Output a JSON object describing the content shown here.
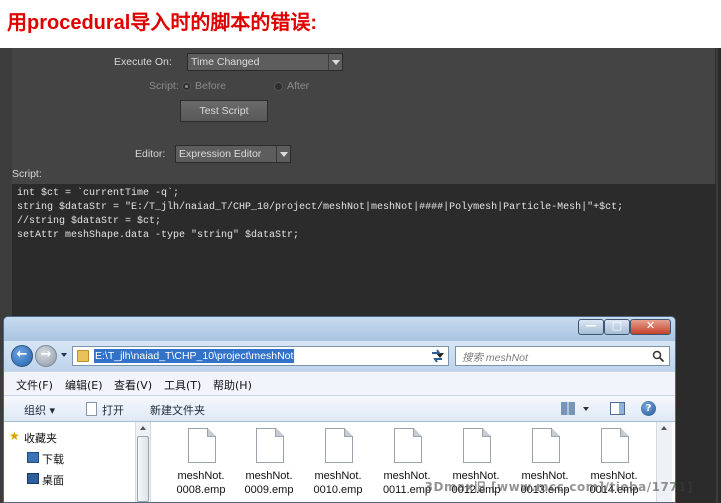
{
  "heading": "用procedural导入时的脚本的错误:",
  "expression_editor": {
    "execute_on_label": "Execute On:",
    "execute_on_value": "Time Changed",
    "script_label": "Script:",
    "before_label": "Before",
    "after_label": "After",
    "test_script_button": "Test Script",
    "editor_label": "Editor:",
    "editor_value": "Expression Editor",
    "script_section_label": "Script:",
    "code_lines": [
      "int $ct = `currentTime -q`;",
      "string $dataStr = \"E:/T_jlh/naiad_T/CHP_10/project/meshNot|meshNot|####|Polymesh|Particle-Mesh|\"+$ct;",
      "//string $dataStr = $ct;",
      "setAttr meshShape.data -type \"string\" $dataStr;"
    ]
  },
  "explorer": {
    "address": "E:\\T_jlh\\naiad_T\\CHP_10\\project\\meshNot",
    "search_placeholder": "搜索 meshNot",
    "menu": [
      "文件(F)",
      "编辑(E)",
      "查看(V)",
      "工具(T)",
      "帮助(H)"
    ],
    "toolbar": {
      "organize": "组织 ▾",
      "open": "打开",
      "new_folder": "新建文件夹"
    },
    "nav_items": [
      "收藏夹",
      "下载",
      "桌面"
    ],
    "files": [
      {
        "line1": "meshNot.",
        "line2": "0008.emp"
      },
      {
        "line1": "meshNot.",
        "line2": "0009.emp"
      },
      {
        "line1": "meshNot.",
        "line2": "0010.emp"
      },
      {
        "line1": "meshNot.",
        "line2": "0011.emp"
      },
      {
        "line1": "meshNot.",
        "line2": "0012.emp"
      },
      {
        "line1": "meshNot.",
        "line2": "0013.emp"
      },
      {
        "line1": "meshNot.",
        "line2": "0014.emp"
      }
    ],
    "window_controls": [
      "—",
      "□",
      "✕"
    ],
    "icons": [
      "back-icon",
      "forward-icon",
      "folder-icon",
      "refresh-icon",
      "search-icon",
      "view-options-icon",
      "preview-pane-icon",
      "help-icon",
      "star-icon",
      "download-folder-icon",
      "desktop-icon",
      "document-file-icon"
    ]
  },
  "watermark": "3Dmax旧 [www.mcc.com]/tieba/1771]",
  "colors": {
    "heading": "#e00000",
    "maya_bg": "#3c3c3c",
    "selection": "#3272c9"
  }
}
